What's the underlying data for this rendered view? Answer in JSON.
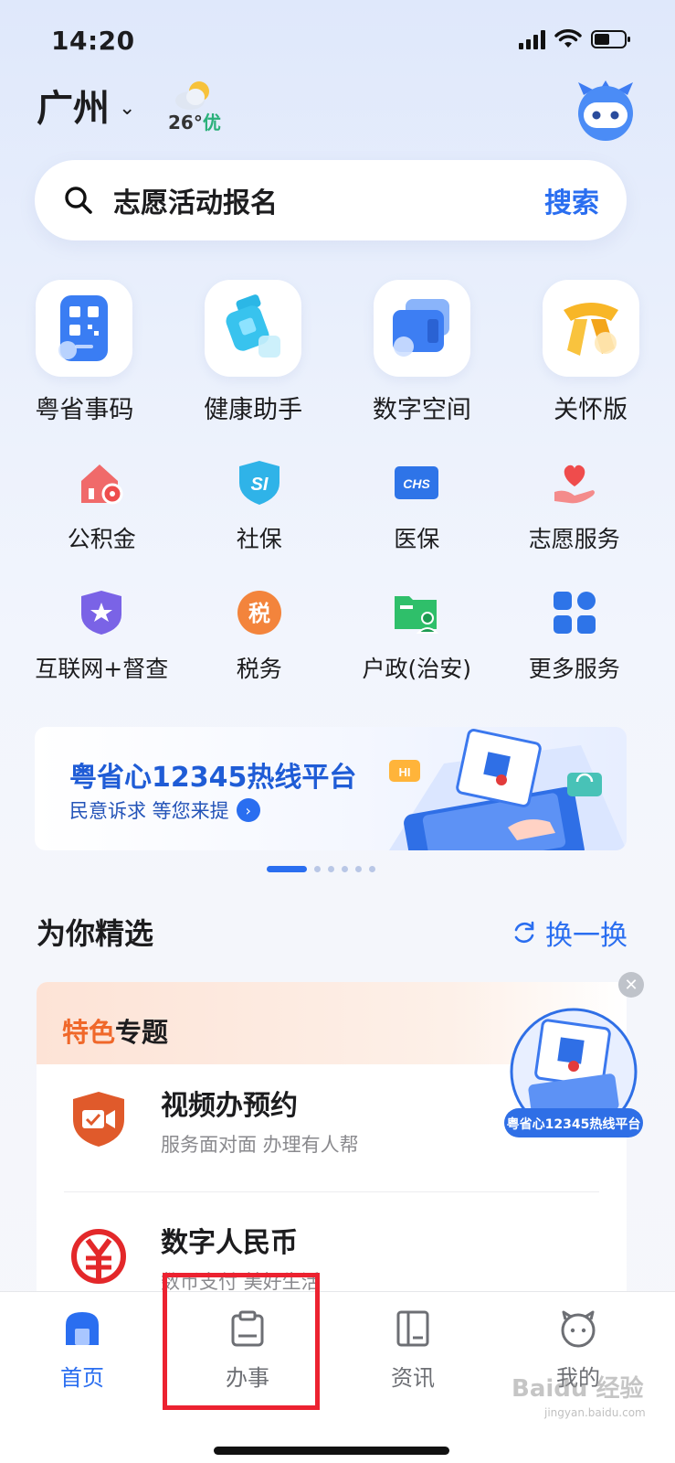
{
  "status_bar": {
    "time": "14:20"
  },
  "header": {
    "city": "广州",
    "weather_temp": "26°",
    "weather_quality": "优"
  },
  "search": {
    "query": "志愿活动报名",
    "button": "搜索"
  },
  "featured_services": [
    {
      "label": "粤省事码",
      "icon": "qr-code-icon"
    },
    {
      "label": "健康助手",
      "icon": "health-kit-icon"
    },
    {
      "label": "数字空间",
      "icon": "digital-wallet-icon"
    },
    {
      "label": "关怀版",
      "icon": "scarf-care-icon"
    }
  ],
  "services": [
    {
      "label": "公积金",
      "icon": "housing-fund-icon"
    },
    {
      "label": "社保",
      "icon": "social-security-icon"
    },
    {
      "label": "医保",
      "icon": "medical-insurance-icon"
    },
    {
      "label": "志愿服务",
      "icon": "volunteer-heart-icon"
    },
    {
      "label": "互联网+督查",
      "icon": "supervision-shield-icon"
    },
    {
      "label": "税务",
      "icon": "tax-icon"
    },
    {
      "label": "户政(治安)",
      "icon": "household-id-icon"
    },
    {
      "label": "更多服务",
      "icon": "more-grid-icon"
    }
  ],
  "banner": {
    "title": "粤省心12345热线平台",
    "subtitle": "民意诉求 等您来提",
    "badge_hi": "HI",
    "slides_total": 6,
    "active_slide": 1
  },
  "picks": {
    "title": "为你精选",
    "refresh": "换一换",
    "card_head_highlight": "特色",
    "card_head_rest": "专题",
    "items": [
      {
        "title": "视频办预约",
        "subtitle": "服务面对面 办理有人帮"
      },
      {
        "title": "数字人民币",
        "subtitle": "数币支付 美好生活"
      }
    ],
    "float_ad_label": "粤省心12345热线平台"
  },
  "tabbar": {
    "tabs": [
      {
        "label": "首页",
        "active": true
      },
      {
        "label": "办事",
        "active": false
      },
      {
        "label": "资讯",
        "active": false
      },
      {
        "label": "我的",
        "active": false
      }
    ]
  },
  "watermark": {
    "text": "Baidu 经验",
    "sub": "jingyan.baidu.com"
  },
  "colors": {
    "accent": "#2a6ef0",
    "highlight_box": "#ec2230",
    "orange": "#f0682a"
  }
}
